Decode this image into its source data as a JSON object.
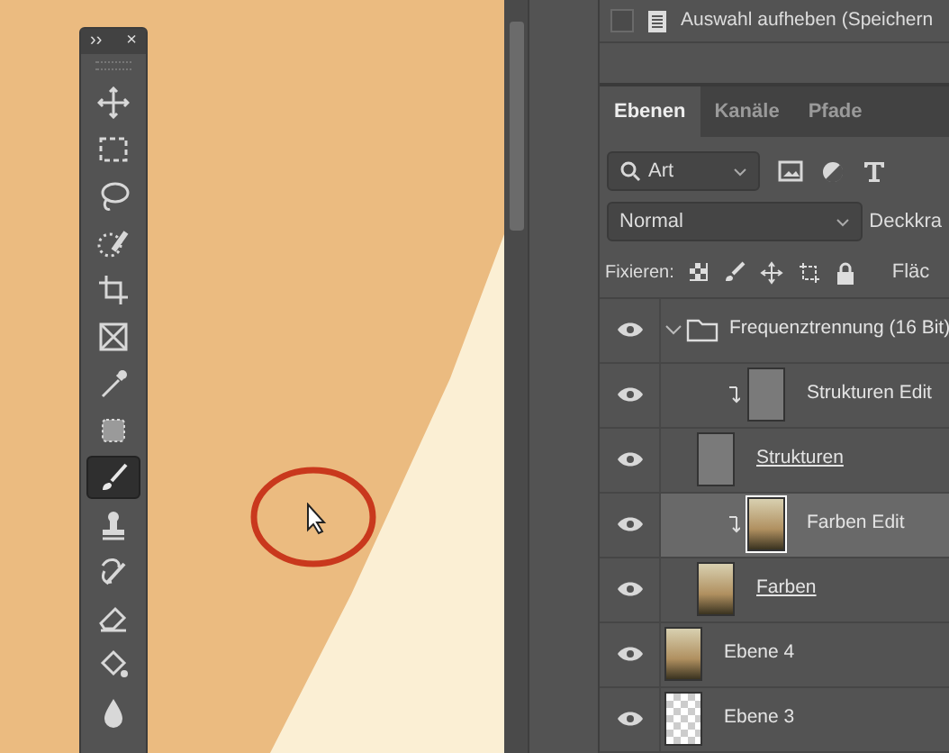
{
  "toolbar": {
    "header": {
      "expand": "››",
      "close": "×"
    },
    "tools": [
      {
        "selected": false
      },
      {
        "selected": false
      },
      {
        "selected": false
      },
      {
        "selected": false
      },
      {
        "selected": false
      },
      {
        "selected": false
      },
      {
        "selected": false
      },
      {
        "selected": false
      },
      {
        "selected": true
      },
      {
        "selected": false
      },
      {
        "selected": false
      },
      {
        "selected": false
      },
      {
        "selected": false
      },
      {
        "selected": false
      }
    ]
  },
  "history": {
    "checked": false,
    "label": "Auswahl aufheben (Speichern"
  },
  "tabs": [
    {
      "label": "Ebenen",
      "selected": true
    },
    {
      "label": "Kanäle",
      "selected": false
    },
    {
      "label": "Pfade",
      "selected": false
    }
  ],
  "filter": {
    "value": "Art"
  },
  "blend": {
    "mode": "Normal",
    "opacity_label": "Deckkra"
  },
  "lock": {
    "label": "Fixieren:",
    "fill_label": "Fläc"
  },
  "layers": [
    {
      "kind": "group",
      "name": "Frequenztrennung (16 Bit)",
      "visible": true,
      "expanded": true,
      "selected": false,
      "children": [
        {
          "kind": "layer",
          "name": "Strukturen Edit",
          "thumb": {
            "kind": "gray"
          },
          "clipped": true,
          "clip_base": false,
          "visible": true,
          "selected": false
        },
        {
          "kind": "layer",
          "name": "Strukturen",
          "thumb": {
            "kind": "gray"
          },
          "clipped": false,
          "clip_base": true,
          "visible": true,
          "selected": false
        },
        {
          "kind": "layer",
          "name": "Farben Edit",
          "thumb": {
            "kind": "photo"
          },
          "clipped": true,
          "clip_base": false,
          "visible": true,
          "selected": true
        },
        {
          "kind": "layer",
          "name": "Farben",
          "thumb": {
            "kind": "photo"
          },
          "clipped": false,
          "clip_base": true,
          "visible": true,
          "selected": false
        }
      ]
    },
    {
      "kind": "layer",
      "name": "Ebene 4",
      "thumb": {
        "kind": "photo"
      },
      "clipped": false,
      "clip_base": false,
      "visible": true,
      "selected": false
    },
    {
      "kind": "layer",
      "name": "Ebene 3",
      "thumb": {
        "kind": "transparent"
      },
      "clipped": false,
      "clip_base": false,
      "visible": true,
      "selected": false
    }
  ]
}
